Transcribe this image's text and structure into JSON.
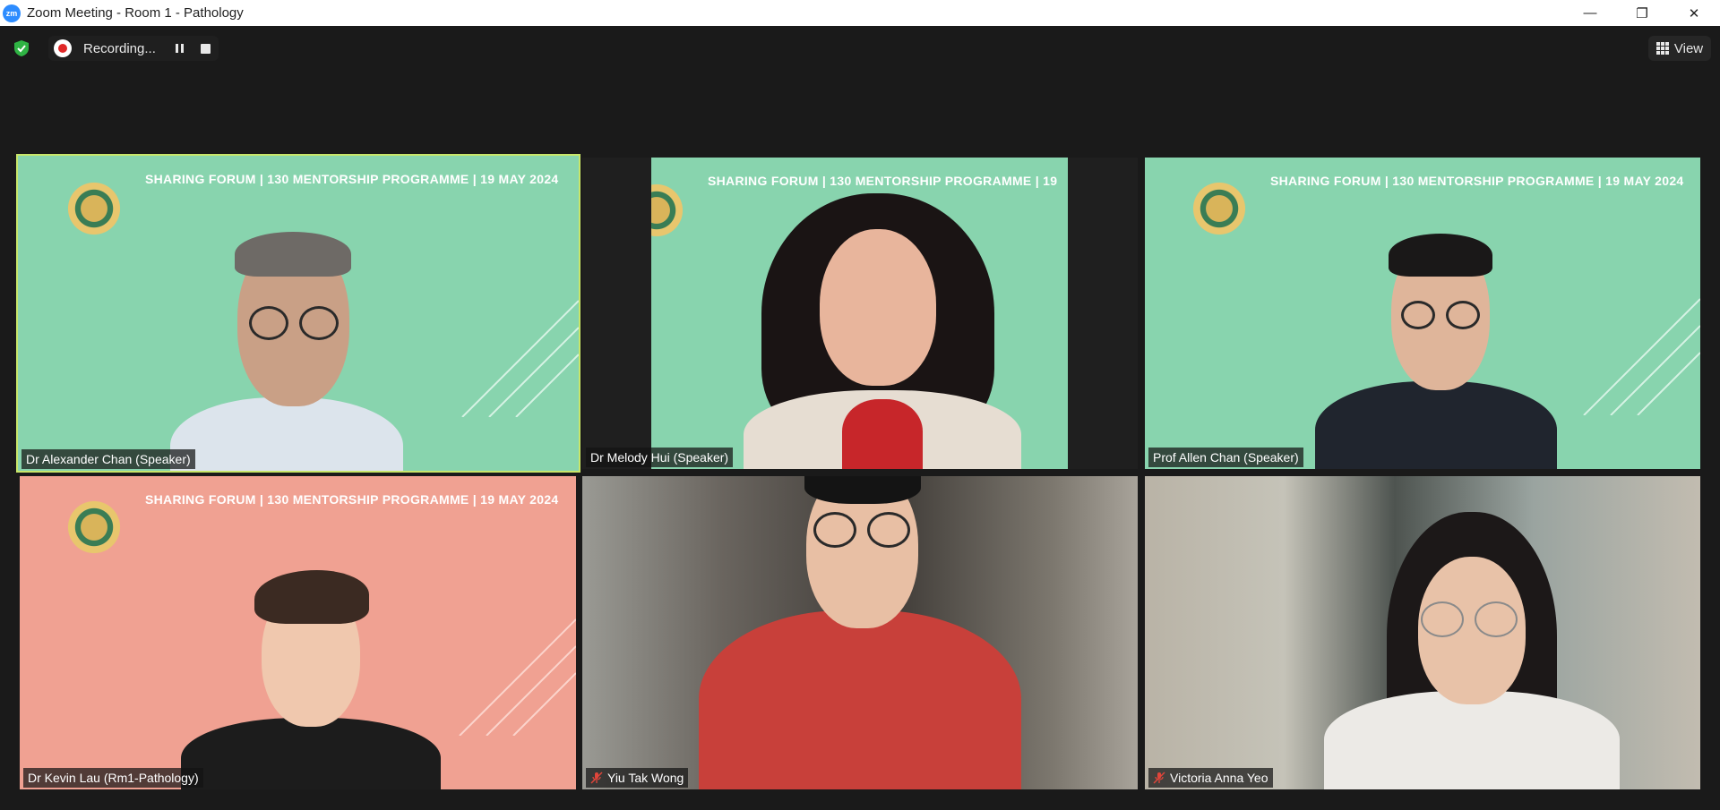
{
  "window": {
    "title": "Zoom Meeting - Room 1 - Pathology",
    "app_icon_text": "zm",
    "controls": {
      "minimize": "—",
      "restore": "❐",
      "close": "✕"
    }
  },
  "toolbar": {
    "recording_label": "Recording...",
    "view_label": "View"
  },
  "banner_text": "SHARING FORUM | 130 MENTORSHIP PROGRAMME | 19 MAY 2024",
  "banner_text_cropped": "SHARING FORUM | 130 MENTORSHIP PROGRAMME | 19",
  "participants": [
    {
      "name": "Dr Alexander Chan (Speaker)",
      "muted": false,
      "active_speaker": true
    },
    {
      "name": "Dr Melody Hui (Speaker)",
      "muted": false,
      "active_speaker": false
    },
    {
      "name": "Prof Allen Chan (Speaker)",
      "muted": false,
      "active_speaker": false
    },
    {
      "name": "Dr Kevin Lau (Rm1-Pathology)",
      "muted": false,
      "active_speaker": false
    },
    {
      "name": "Yiu Tak Wong",
      "muted": true,
      "active_speaker": false
    },
    {
      "name": "Victoria Anna Yeo",
      "muted": true,
      "active_speaker": false
    }
  ],
  "colors": {
    "tile_green": "#88d4ae",
    "tile_pink": "#f0a192",
    "active_border": "#c8e66a",
    "record_red": "#e02828",
    "shield_green": "#2fb344"
  }
}
